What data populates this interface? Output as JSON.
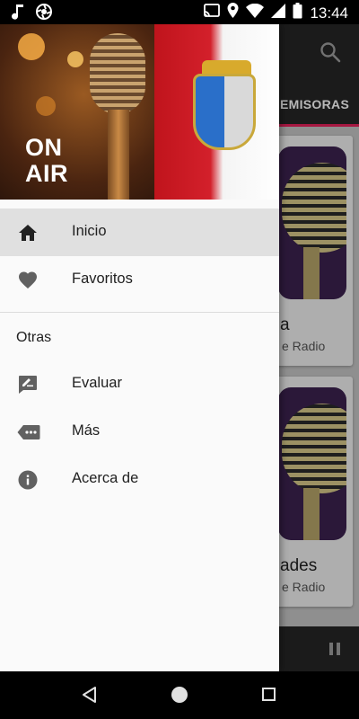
{
  "status_bar": {
    "time": "13:44",
    "left_icons": [
      "music-note-icon",
      "aperture-icon"
    ],
    "right_icons": [
      "cast-icon",
      "location-icon",
      "wifi-icon",
      "cellular-icon",
      "battery-icon"
    ]
  },
  "background_app": {
    "tab_label": "EMISORAS",
    "accent_color": "#e6215b",
    "cards": [
      {
        "title": "a",
        "subtitle": "e Radio"
      },
      {
        "title": "ades",
        "subtitle": "e Radio"
      }
    ]
  },
  "drawer": {
    "header": {
      "badge_line1": "ON",
      "badge_line2": "AIR"
    },
    "primary_items": [
      {
        "label": "Inicio",
        "icon": "home-icon",
        "selected": true
      },
      {
        "label": "Favoritos",
        "icon": "heart-icon",
        "selected": false
      }
    ],
    "section_title": "Otras",
    "secondary_items": [
      {
        "label": "Evaluar",
        "icon": "rate-review-icon"
      },
      {
        "label": "Más",
        "icon": "more-tag-icon"
      },
      {
        "label": "Acerca de",
        "icon": "info-icon"
      }
    ]
  },
  "nav_bar": {
    "buttons": [
      "back-icon",
      "home-circle-icon",
      "recents-square-icon"
    ]
  }
}
